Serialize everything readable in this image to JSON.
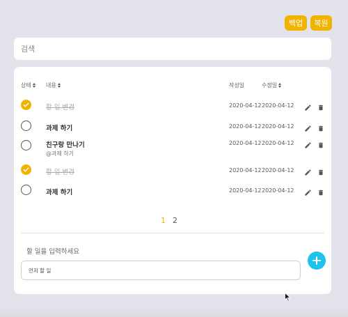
{
  "header": {
    "backup_label": "백업",
    "restore_label": "복원"
  },
  "search": {
    "placeholder": "검색",
    "value": ""
  },
  "table": {
    "columns": {
      "status": "상태",
      "content": "내용",
      "created": "작성일",
      "modified": "수정일"
    },
    "rows": [
      {
        "done": true,
        "content": "할 일 변경",
        "tag": "",
        "created": "2020-04-12",
        "modified": "2020-04-12"
      },
      {
        "done": false,
        "content": "과제 하기",
        "tag": "",
        "created": "2020-04-12",
        "modified": "2020-04-12"
      },
      {
        "done": false,
        "content": "친구랑 만나기",
        "tag": "@과제 하기",
        "created": "2020-04-12",
        "modified": "2020-04-12"
      },
      {
        "done": true,
        "content": "할 일 변경",
        "tag": "",
        "created": "2020-04-12",
        "modified": "2020-04-12"
      },
      {
        "done": false,
        "content": "과제 하기",
        "tag": "",
        "created": "2020-04-12",
        "modified": "2020-04-12"
      }
    ]
  },
  "pagination": {
    "pages": [
      "1",
      "2"
    ],
    "current": "1"
  },
  "new_todo": {
    "label": "할 일을 입력하세요",
    "placeholder": "먼저 할 일",
    "value": ""
  },
  "icons": {
    "edit": "pencil-icon",
    "delete": "trash-icon",
    "add": "plus-icon",
    "checked": "check-icon"
  },
  "colors": {
    "accent": "#f0b400",
    "add_button": "#1fc2ec",
    "background": "#e3e3ec"
  }
}
